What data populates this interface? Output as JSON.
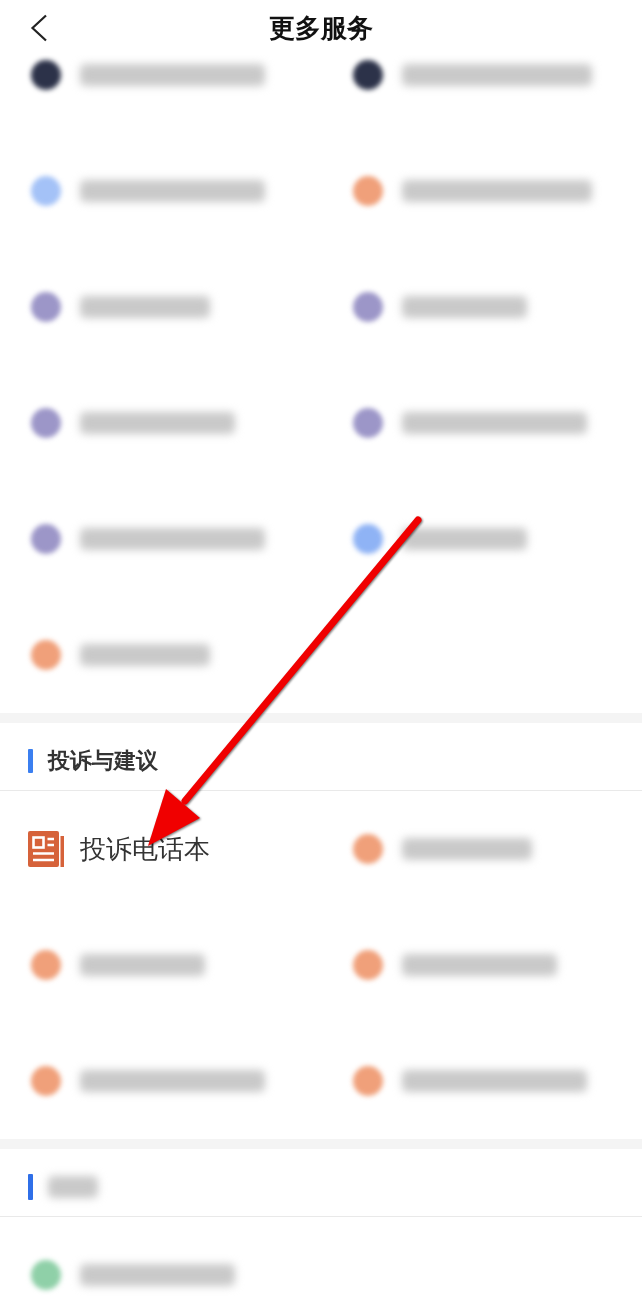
{
  "header": {
    "title": "更多服务"
  },
  "sections": [
    {
      "items": [
        {
          "kind": "blurred",
          "color": "#2c3249"
        },
        {
          "kind": "blurred",
          "color": "#2c3249"
        },
        {
          "kind": "blurred",
          "color": "#a4c2f7"
        },
        {
          "kind": "blurred",
          "color": "#f0a07a"
        },
        {
          "kind": "blurred",
          "color": "#9c96c8"
        },
        {
          "kind": "blurred",
          "color": "#9c96c8"
        },
        {
          "kind": "blurred",
          "color": "#9c96c8"
        },
        {
          "kind": "blurred",
          "color": "#9c96c8"
        },
        {
          "kind": "blurred",
          "color": "#9c96c8"
        },
        {
          "kind": "blurred",
          "color": "#8fb3f5"
        },
        {
          "kind": "blurred",
          "color": "#f0a07a"
        }
      ]
    },
    {
      "header": {
        "kind": "text",
        "text": "投诉与建议"
      },
      "items": [
        {
          "kind": "service",
          "label": "投诉电话本",
          "color": "#d6623a"
        },
        {
          "kind": "blurred",
          "color": "#f0a07a"
        },
        {
          "kind": "blurred",
          "color": "#f0a07a"
        },
        {
          "kind": "blurred",
          "color": "#f0a07a"
        },
        {
          "kind": "blurred",
          "color": "#f0a07a"
        },
        {
          "kind": "blurred",
          "color": "#f0a07a"
        }
      ]
    },
    {
      "header": {
        "kind": "blurred"
      },
      "items": [
        {
          "kind": "blurred",
          "color": "#8fd0a8"
        }
      ]
    }
  ],
  "annotations": [
    {
      "kind": "arrow"
    }
  ]
}
